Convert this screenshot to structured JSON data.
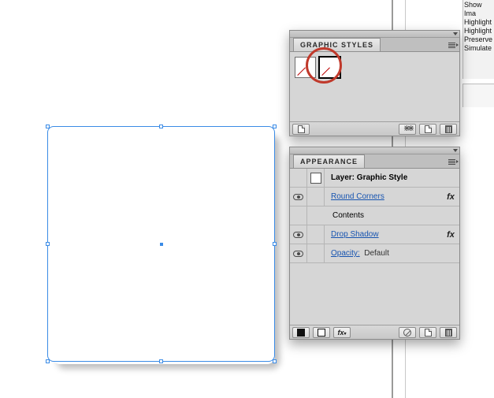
{
  "right_strip": {
    "line1": "Show Ima",
    "line2": "Highlight",
    "line3": "Highlight",
    "line4": "Preserve",
    "line5": "Simulate"
  },
  "graphic_styles": {
    "tab_label": "GRAPHIC STYLES",
    "swatches": [
      "default-style",
      "current-style"
    ]
  },
  "appearance": {
    "tab_label": "APPEARANCE",
    "layer_label": "Layer: Graphic Style",
    "rows": {
      "round_corners": "Round Corners",
      "contents": "Contents",
      "drop_shadow": "Drop Shadow",
      "opacity_label": "Opacity:",
      "opacity_value": "Default"
    },
    "fx_glyph": "fx"
  }
}
